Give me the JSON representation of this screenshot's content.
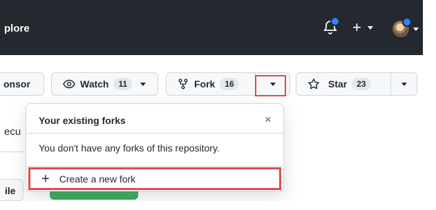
{
  "header": {
    "nav_partial": "plore",
    "icons": [
      "bell-icon",
      "plus-icon",
      "avatar"
    ]
  },
  "toolbar": {
    "sponsor_label": "onsor",
    "watch_label": "Watch",
    "watch_count": "11",
    "fork_label": "Fork",
    "fork_count": "16",
    "star_label": "Star",
    "star_count": "23"
  },
  "popover": {
    "title": "Your existing forks",
    "close_symbol": "×",
    "message": "You don't have any forks of this repository.",
    "create_fork_label": "Create a new fork"
  },
  "background": {
    "side_text": "ecu",
    "file_button_label": "ile"
  },
  "colors": {
    "header_bg": "#24292f",
    "highlight_red": "#e04b4b",
    "green_button": "#2da44e",
    "notification_blue": "#2f81f7"
  }
}
